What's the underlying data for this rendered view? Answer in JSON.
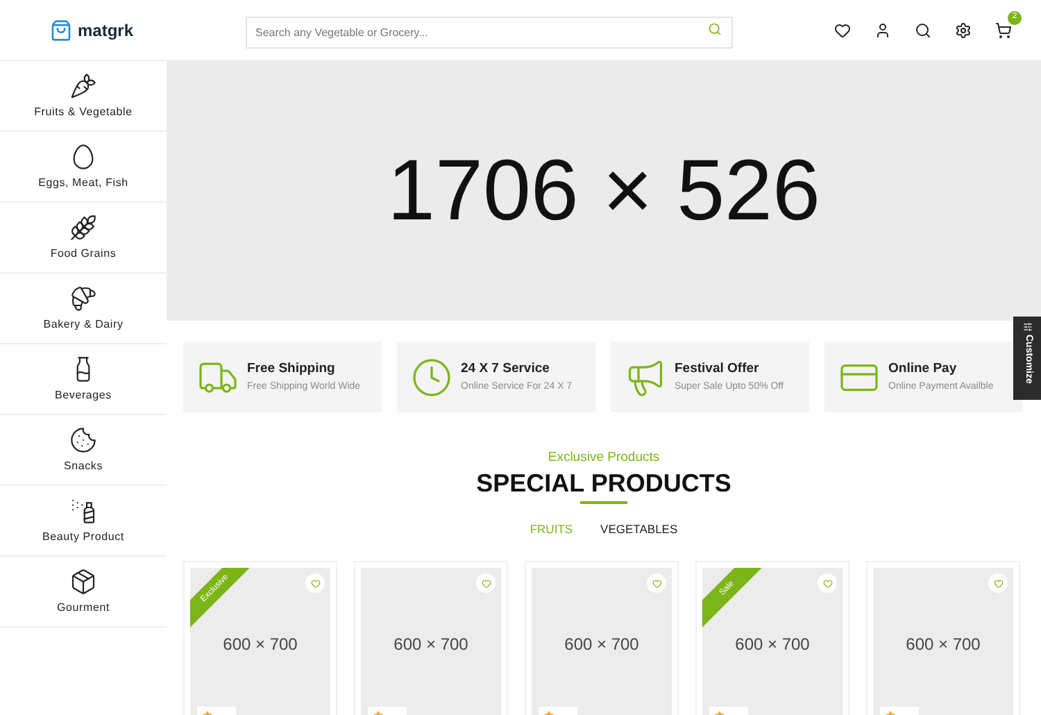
{
  "header": {
    "logo": "matgrk",
    "search": {
      "placeholder": "Search any Vegetable or Grocery..."
    },
    "cart_count": "2"
  },
  "sidebar": {
    "items": [
      {
        "kind": "fruits",
        "label": "Fruits & Vegetable"
      },
      {
        "kind": "eggs",
        "label": "Eggs, Meat, Fish"
      },
      {
        "kind": "grains",
        "label": "Food Grains"
      },
      {
        "kind": "bakery",
        "label": "Bakery & Dairy"
      },
      {
        "kind": "beverages",
        "label": "Beverages"
      },
      {
        "kind": "snacks",
        "label": "Snacks"
      },
      {
        "kind": "beauty",
        "label": "Beauty Product"
      },
      {
        "kind": "gourmet",
        "label": "Gourment"
      }
    ]
  },
  "banner": {
    "text": "1706 × 526"
  },
  "features": [
    {
      "kind": "shipping",
      "title": "Free Shipping",
      "subtitle": "Free Shipping World Wide"
    },
    {
      "kind": "service",
      "title": "24 X 7 Service",
      "subtitle": "Online Service For 24 X 7"
    },
    {
      "kind": "offer",
      "title": "Festival Offer",
      "subtitle": "Super Sale Upto 50% Off"
    },
    {
      "kind": "pay",
      "title": "Online Pay",
      "subtitle": "Online Payment Availble"
    }
  ],
  "customize": "Customize",
  "section": {
    "subtitle": "Exclusive Products",
    "title": "SPECIAL PRODUCTS",
    "tabs": [
      {
        "label": "FRUITS",
        "selected": true
      },
      {
        "label": "VEGETABLES",
        "selected": false
      }
    ]
  },
  "products": [
    {
      "image": "600 × 700",
      "ribbon": "Exclusive"
    },
    {
      "image": "600 × 700"
    },
    {
      "image": "600 × 700"
    },
    {
      "image": "600 × 700",
      "ribbon": "Sale"
    },
    {
      "image": "600 × 700"
    }
  ]
}
